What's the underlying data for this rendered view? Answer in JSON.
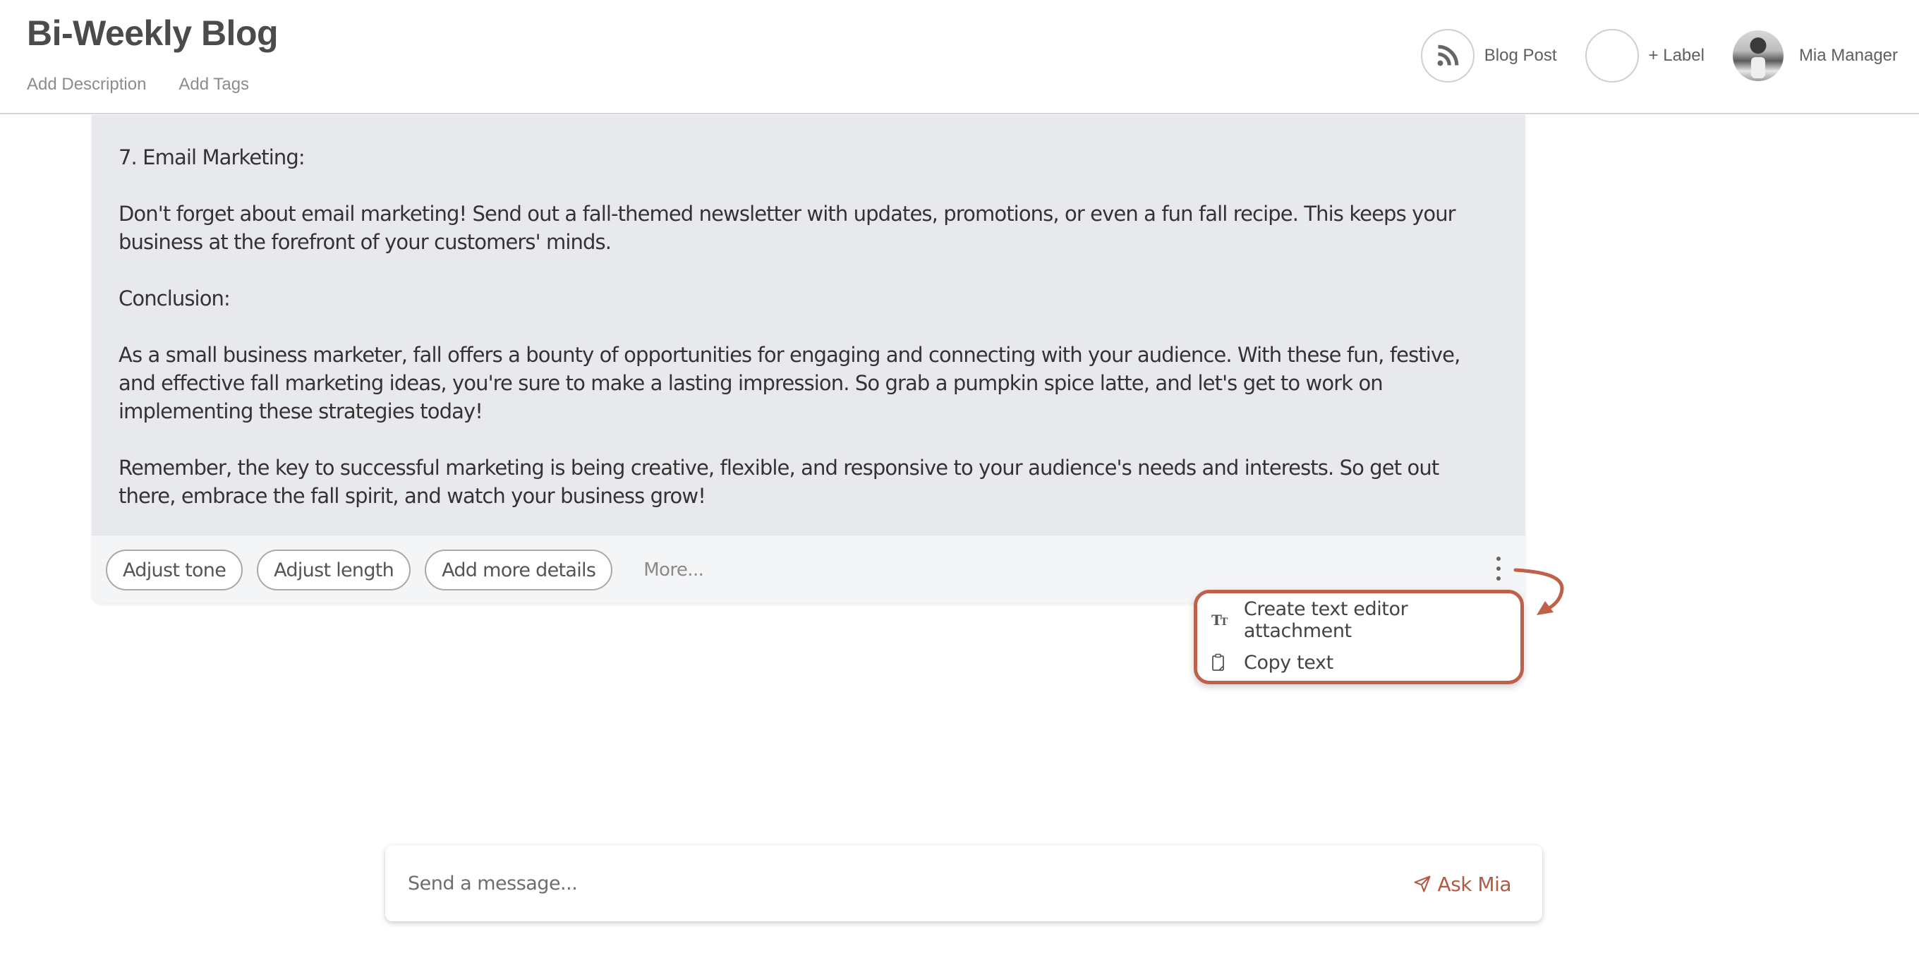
{
  "header": {
    "title": "Bi-Weekly Blog",
    "add_description": "Add Description",
    "add_tags": "Add Tags",
    "type_label": "Blog Post",
    "type_icon": "rss-icon",
    "label_button": "+ Label",
    "user_name": "Mia Manager"
  },
  "content": {
    "paragraphs": [
      "7. Email Marketing:",
      "Don't forget about email marketing! Send out a fall-themed newsletter with updates, promotions, or even a fun fall recipe. This keeps your business at the forefront of your customers' minds.",
      "Conclusion:",
      "As a small business marketer, fall offers a bounty of opportunities for engaging and connecting with your audience. With these fun, festive, and effective fall marketing ideas, you're sure to make a lasting impression. So grab a pumpkin spice latte, and let's get to work on implementing these strategies today!",
      "Remember, the key to successful marketing is being creative, flexible, and responsive to your audience's needs and interests. So get out there, embrace the fall spirit, and watch your business grow!"
    ]
  },
  "actions": {
    "chips": [
      "Adjust tone",
      "Adjust length",
      "Add more details"
    ],
    "more": "More..."
  },
  "menu": {
    "items": [
      {
        "label": "Create text editor attachment",
        "icon": "text-format-icon"
      },
      {
        "label": "Copy text",
        "icon": "clipboard-icon"
      }
    ]
  },
  "composer": {
    "placeholder": "Send a message...",
    "value": "",
    "send_label": "Ask Mia"
  },
  "colors": {
    "accent": "#bf6048",
    "send": "#b35a43",
    "card_bg": "#e8e9ec"
  }
}
